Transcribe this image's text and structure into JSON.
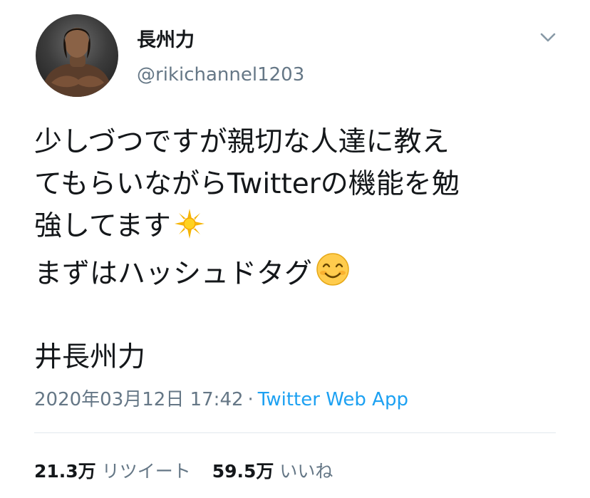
{
  "user": {
    "display_name": "長州力",
    "handle": "@rikichannel1203"
  },
  "tweet": {
    "lines": [
      "少しづつですが親切な人達に教え",
      "てもらいながらTwitterの機能を勉",
      "強してます",
      "まずはハッシュドタグ"
    ],
    "emojis": [
      "sparkle-sun-emoji",
      "smiling-face-emoji"
    ],
    "hashtag_line": "井長州力"
  },
  "meta": {
    "timestamp": "2020年03月12日 17:42",
    "separator": "·",
    "source": "Twitter Web App"
  },
  "stats": {
    "retweets_count": "21.3万",
    "retweets_label": "リツイート",
    "likes_count": "59.5万",
    "likes_label": "いいね"
  },
  "colors": {
    "text": "#14171a",
    "secondary": "#657786",
    "link": "#1da1f2",
    "divider": "#e1e8ed"
  }
}
